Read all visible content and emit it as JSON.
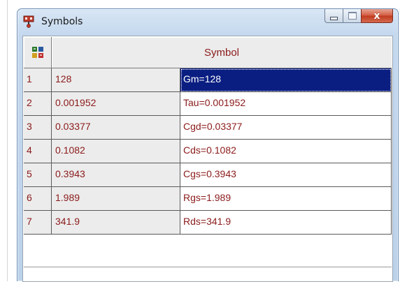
{
  "window": {
    "title": "Symbols",
    "close_glyph": "x"
  },
  "grid": {
    "header": "Symbol",
    "corner_icon": "grid-options-icon",
    "rows": [
      {
        "index": "1",
        "value": "128",
        "symbol": "Gm=128",
        "selected": true
      },
      {
        "index": "2",
        "value": "0.001952",
        "symbol": "Tau=0.001952"
      },
      {
        "index": "3",
        "value": "0.03377",
        "symbol": "Cgd=0.03377"
      },
      {
        "index": "4",
        "value": "0.1082",
        "symbol": "Cds=0.1082"
      },
      {
        "index": "5",
        "value": "0.3943",
        "symbol": "Cgs=0.3943"
      },
      {
        "index": "6",
        "value": "1.989",
        "symbol": "Rgs=1.989"
      },
      {
        "index": "7",
        "value": "341.9",
        "symbol": "Rds=341.9"
      }
    ]
  },
  "colors": {
    "text": "#8b1a1a",
    "selection": "#0a1e82",
    "cell_bg": "#ececec"
  }
}
